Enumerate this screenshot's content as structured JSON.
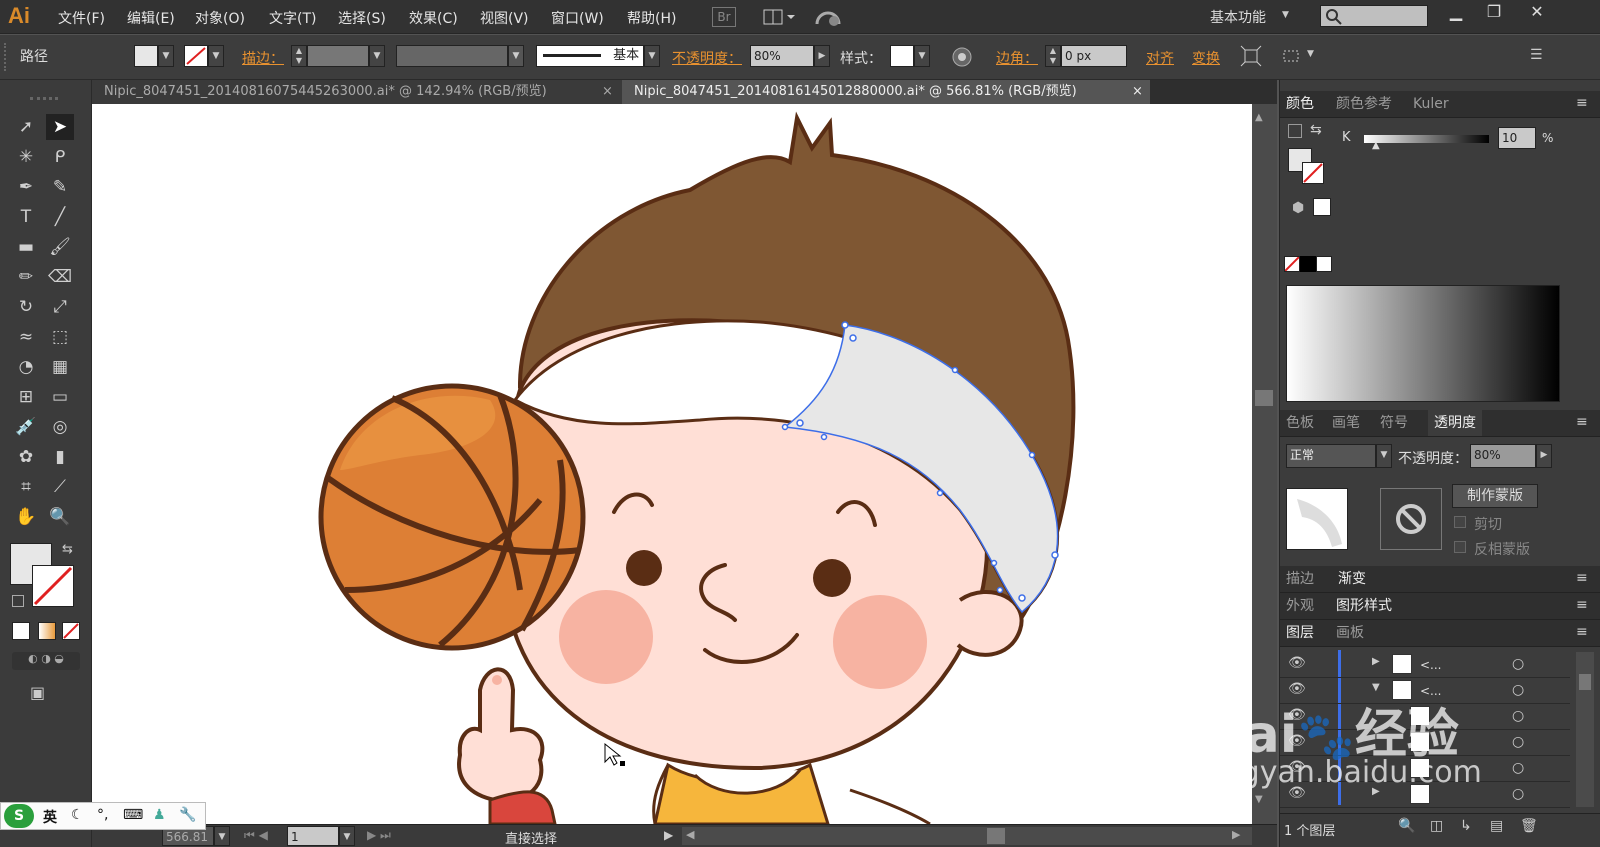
{
  "app": {
    "logo": "Ai",
    "workspace": "基本功能"
  },
  "menu": [
    "文件(F)",
    "编辑(E)",
    "对象(O)",
    "文字(T)",
    "选择(S)",
    "效果(C)",
    "视图(V)",
    "窗口(W)",
    "帮助(H)"
  ],
  "toolbar_extra": {
    "br": "Br"
  },
  "control": {
    "selection_type": "路径",
    "stroke_label": "描边：",
    "line_style": "基本",
    "opacity_label": "不透明度：",
    "opacity_value": "80%",
    "style_label": "样式：",
    "corner_label": "边角：",
    "corner_value": "0 px",
    "align": "对齐",
    "transform": "变换"
  },
  "tabs": [
    {
      "label": "Nipic_8047451_20140816075445263000.ai* @ 142.94% (RGB/预览)",
      "close": "×"
    },
    {
      "label": "Nipic_8047451_20140816145012880000.ai* @ 566.81% (RGB/预览)",
      "close": "×"
    }
  ],
  "panels": {
    "color_tabs": [
      "颜色",
      "颜色参考",
      "Kuler"
    ],
    "k_label": "K",
    "k_value": "10",
    "percent": "%",
    "swatch_tabs": [
      "色板",
      "画笔",
      "符号",
      "透明度"
    ],
    "blend_mode": "正常",
    "opacity_label": "不透明度：",
    "opacity_value": "80%",
    "make_mask": "制作蒙版",
    "clip": "剪切",
    "invert_mask": "反相蒙版",
    "stroke_tabs": [
      "描边",
      "渐变"
    ],
    "appearance_tabs": [
      "外观",
      "图形样式"
    ],
    "layer_tabs": [
      "图层",
      "画板"
    ],
    "layer_rows": [
      {
        "name": "<..."
      },
      {
        "name": "<..."
      },
      {
        "name": ""
      },
      {
        "name": ""
      },
      {
        "name": ""
      },
      {
        "name": ""
      }
    ],
    "layer_count": "1 个图层"
  },
  "status": {
    "zoom": "566.81",
    "page": "1",
    "tool": "直接选择"
  },
  "ime": {
    "mode": "英"
  },
  "watermark": {
    "brand": "Bai",
    "brand2": "经验",
    "url": "jingyan.baidu.com"
  },
  "colors": {
    "hair": "#7f5733",
    "headband": "#e7e7e7",
    "skin": "#ffdfd6",
    "ball": "#dd7f35",
    "outline": "#5a2d14",
    "cheek": "#f7b3a2",
    "selection": "#3d6ee8",
    "accent": "#e8912f"
  }
}
